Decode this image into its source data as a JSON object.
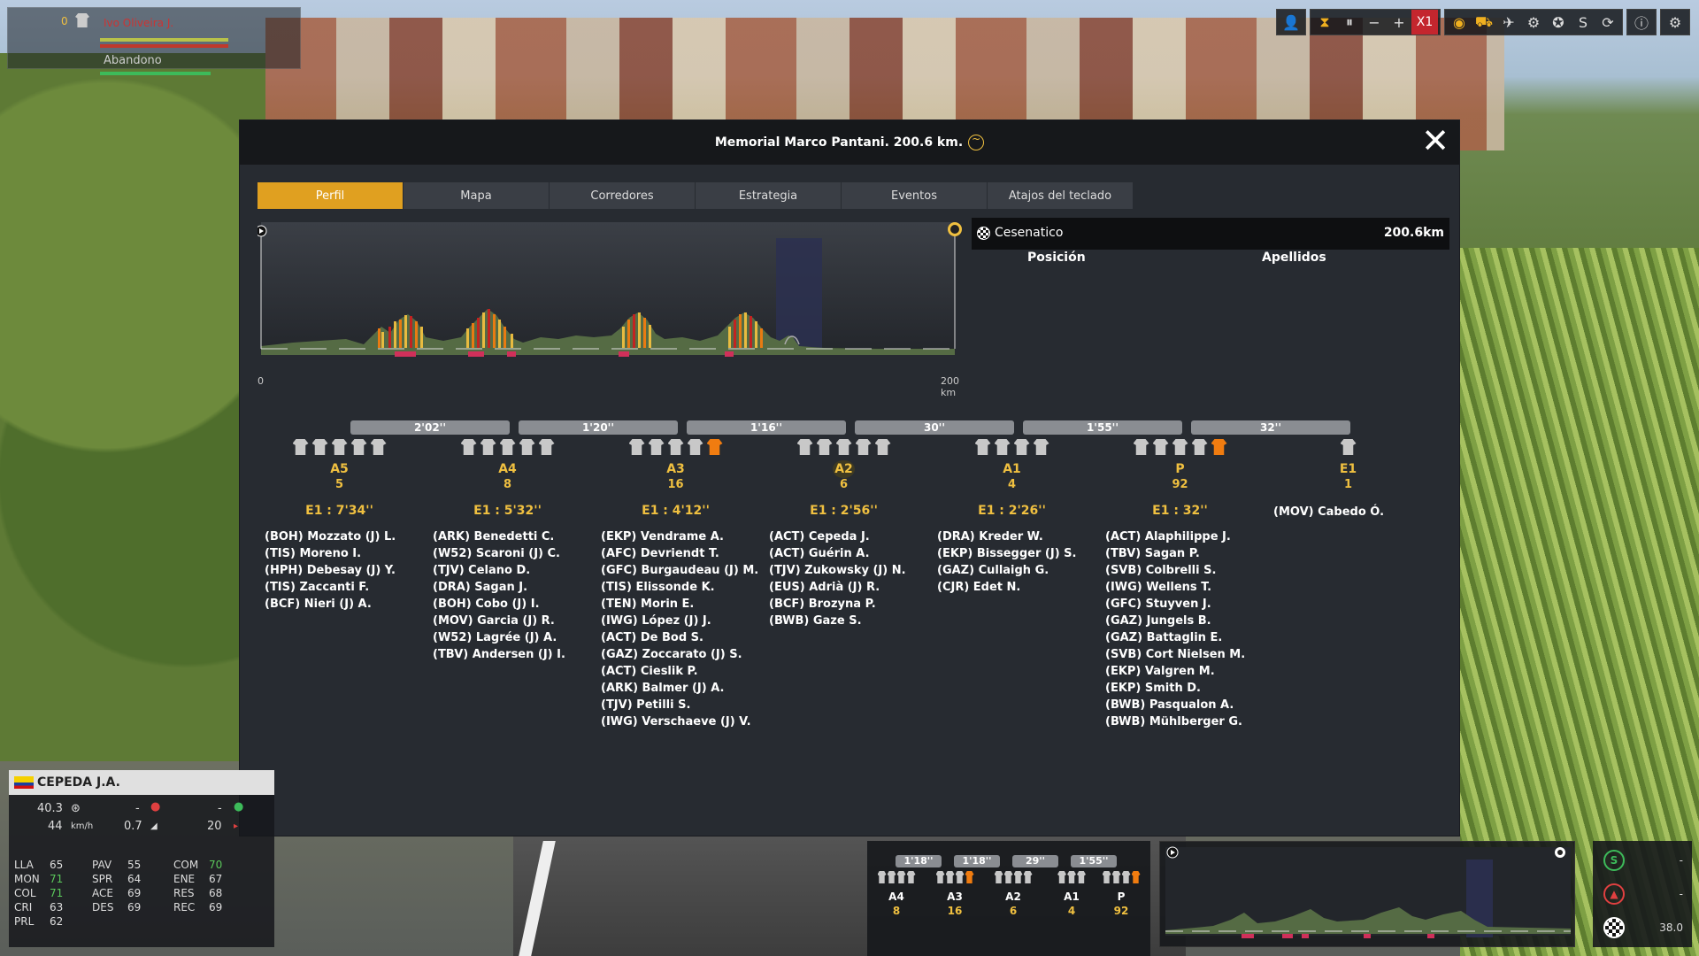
{
  "top_status": {
    "number": "0",
    "name": "Ivo Oliveira J.",
    "status": "Abandono"
  },
  "toolbar": {
    "speed_label": "X1",
    "icons": [
      "user-icon",
      "hourglass-icon",
      "pause-icon",
      "minus-icon",
      "plus-icon",
      "x1-speed",
      "eye-icon",
      "motorbike-icon",
      "plane-icon",
      "helicopter-icon",
      "wheel-icon",
      "sprint-icon",
      "refresh-icon",
      "info-icon",
      "gear-icon"
    ]
  },
  "modal": {
    "title": "Memorial Marco Pantani. 200.6 km.",
    "close": "✕",
    "tabs": [
      "Perfil",
      "Mapa",
      "Corredores",
      "Estrategia",
      "Eventos",
      "Atajos del teclado"
    ],
    "active_tab": 0,
    "profile": {
      "start_km": "0",
      "end_km": "200 km"
    },
    "finish": {
      "name": "Cesenatico",
      "distance": "200.6km"
    },
    "table_headers": {
      "position": "Posición",
      "surname": "Apellidos"
    },
    "gaps": [
      "2'02''",
      "1'20''",
      "1'16''",
      "30''",
      "1'55''",
      "32''"
    ],
    "groups": [
      {
        "name": "A5",
        "count": "5",
        "time": "E1 : 7'34''",
        "jerseys": [
          "w",
          "w",
          "w",
          "w",
          "w"
        ],
        "riders": [
          "(BOH) Mozzato (J) L.",
          "(TIS) Moreno I.",
          "(HPH) Debesay (J) Y.",
          "(TIS) Zaccanti F.",
          "(BCF) Nieri (J) A."
        ]
      },
      {
        "name": "A4",
        "count": "8",
        "time": "E1 : 5'32''",
        "jerseys": [
          "w",
          "w",
          "w",
          "w",
          "w"
        ],
        "riders": [
          "(ARK) Benedetti C.",
          "(W52) Scaroni (J) C.",
          "(TJV) Celano D.",
          "(DRA) Sagan J.",
          "(BOH) Cobo (J) I.",
          "(MOV) Garcia (J) R.",
          "(W52) Lagrée (J) A.",
          "(TBV) Andersen (J) I."
        ]
      },
      {
        "name": "A3",
        "count": "16",
        "time": "E1 : 4'12''",
        "jerseys": [
          "w",
          "w",
          "w",
          "w",
          "o"
        ],
        "riders": [
          "(EKP) Vendrame A.",
          "(AFC) Devriendt T.",
          "(GFC) Burgaudeau (J) M.",
          "(TIS) Elissonde K.",
          "(TEN) Morin E.",
          "(IWG) López (J) J.",
          "(ACT) De Bod S.",
          "(GAZ) Zoccarato (J) S.",
          "(ACT) Cieslik P.",
          "(ARK) Balmer (J) A.",
          "(TJV) Petilli S.",
          "(IWG) Verschaeve (J) V."
        ]
      },
      {
        "name": "A2",
        "count": "6",
        "time": "E1 : 2'56''",
        "jerseys": [
          "w",
          "w",
          "w",
          "w",
          "w"
        ],
        "riders": [
          "(ACT) Cepeda J.",
          "(ACT) Guérin A.",
          "(TJV) Zukowsky (J) N.",
          "(EUS) Adrià (J) R.",
          "(BCF) Brozyna P.",
          "(BWB) Gaze S."
        ]
      },
      {
        "name": "A1",
        "count": "4",
        "time": "E1 : 2'26''",
        "jerseys": [
          "w",
          "w",
          "w",
          "w"
        ],
        "riders": [
          "(DRA) Kreder W.",
          "(EKP) Bissegger (J) S.",
          "(GAZ) Cullaigh G.",
          "(CJR) Edet N."
        ]
      },
      {
        "name": "P",
        "count": "92",
        "time": "E1 : 32''",
        "jerseys": [
          "w",
          "w",
          "w",
          "w",
          "o"
        ],
        "riders": [
          "(ACT) Alaphilippe J.",
          "(TBV) Sagan P.",
          "(SVB) Colbrelli S.",
          "(IWG) Wellens T.",
          "(GFC) Stuyven J.",
          "(GAZ) Jungels B.",
          "(GAZ) Battaglin E.",
          "(SVB) Cort Nielsen M.",
          "(EKP) Valgren M.",
          "(EKP) Smith D.",
          "(BWB) Pasqualon A.",
          "(BWB) Mühlberger G."
        ]
      },
      {
        "name": "E1",
        "count": "1",
        "time": "",
        "jerseys": [
          "w"
        ],
        "riders": [
          "(MOV) Cabedo Ó."
        ]
      }
    ]
  },
  "rider": {
    "name": "CEPEDA J.A.",
    "distance": "40.3",
    "speed": "44",
    "speed_unit": "km/h",
    "dash1": "-",
    "grade": "0.7",
    "dash2": "-",
    "energy": "20",
    "attrs": [
      [
        "LLA",
        "65",
        "PAV",
        "55",
        "COM",
        "70"
      ],
      [
        "MON",
        "71",
        "SPR",
        "64",
        "ENE",
        "67"
      ],
      [
        "COL",
        "71",
        "ACE",
        "69",
        "RES",
        "68"
      ],
      [
        "CRI",
        "63",
        "DES",
        "69",
        "REC",
        "69"
      ],
      [
        "PRL",
        "62",
        "",
        "",
        "",
        ""
      ]
    ]
  },
  "mini": {
    "gaps": [
      "1'18''",
      "1'18''",
      "29''",
      "1'55''"
    ],
    "groups": [
      {
        "name": "A4",
        "count": "8"
      },
      {
        "name": "A3",
        "count": "16"
      },
      {
        "name": "A2",
        "count": "6"
      },
      {
        "name": "A1",
        "count": "4"
      },
      {
        "name": "P",
        "count": "92"
      }
    ]
  },
  "side": {
    "sprint": "-",
    "climb": "-",
    "finish_dist": "38.0"
  }
}
